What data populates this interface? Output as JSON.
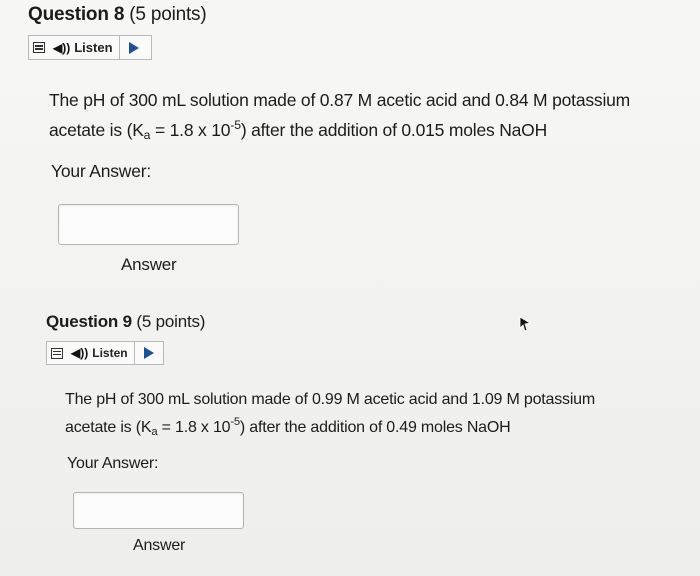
{
  "q8": {
    "title_num": "Question 8",
    "title_pts": "(5 points)",
    "listen_label": "Listen",
    "text_line1": "The pH of 300 mL solution made of 0.87 M acetic acid and 0.84 M potassium",
    "text_pre": "acetate is (K",
    "text_sub": "a",
    "text_mid": " = 1.8 x 10",
    "text_sup": "-5",
    "text_post": ") after the addition of 0.015 moles NaOH",
    "your_answer": "Your Answer:",
    "answer_value": "",
    "answer_label": "Answer"
  },
  "q9": {
    "title_num": "Question 9",
    "title_pts": "(5 points)",
    "listen_label": "Listen",
    "text_line1": "The pH of 300 mL solution made of 0.99 M acetic acid and 1.09 M potassium",
    "text_pre": "acetate is (K",
    "text_sub": "a",
    "text_mid": " = 1.8 x 10",
    "text_sup": "-5",
    "text_post": ") after the addition of 0.49 moles NaOH",
    "your_answer": "Your Answer:",
    "answer_value": "",
    "answer_label": "Answer"
  },
  "icons": {
    "menu": "menu-icon",
    "speaker": "speaker-icon",
    "play": "play-icon",
    "cursor": "mouse-cursor-icon"
  },
  "colors": {
    "play_accent": "#1d4f91",
    "input_border": "#b5b5b5"
  }
}
